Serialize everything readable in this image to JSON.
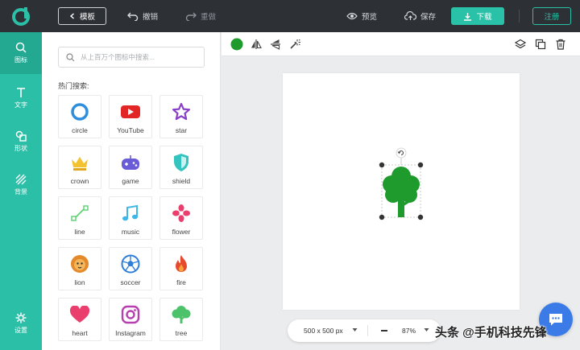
{
  "topbar": {
    "back_label": "模板",
    "undo_label": "撤销",
    "redo_label": "重做",
    "preview_label": "预览",
    "save_label": "保存",
    "download_label": "下载",
    "register_label": "注册"
  },
  "rail": {
    "items": [
      {
        "label": "图标",
        "icon": "search-icon"
      },
      {
        "label": "文字",
        "icon": "text-icon"
      },
      {
        "label": "形状",
        "icon": "shapes-icon"
      },
      {
        "label": "背景",
        "icon": "background-icon"
      },
      {
        "label": "设置",
        "icon": "settings-icon"
      }
    ]
  },
  "panel": {
    "search_placeholder": "从上百万个图标中搜索...",
    "hot_label": "热门搜索:",
    "icons": [
      {
        "label": "circle",
        "icon": "circle-icon",
        "color": "#2f8fdc"
      },
      {
        "label": "YouTube",
        "icon": "youtube-icon",
        "color": "#e22626"
      },
      {
        "label": "star",
        "icon": "star-icon",
        "color": "#8a3fc8"
      },
      {
        "label": "crown",
        "icon": "crown-icon",
        "color": "#f2c230"
      },
      {
        "label": "game",
        "icon": "gamepad-icon",
        "color": "#6a5bd6"
      },
      {
        "label": "shield",
        "icon": "shield-icon",
        "color": "#33c4c0"
      },
      {
        "label": "line",
        "icon": "line-icon",
        "color": "#5ad06e"
      },
      {
        "label": "music",
        "icon": "music-icon",
        "color": "#3fb6e8"
      },
      {
        "label": "flower",
        "icon": "flower-icon",
        "color": "#ea3f6e"
      },
      {
        "label": "lion",
        "icon": "lion-icon",
        "color": "#e48a2a"
      },
      {
        "label": "soccer",
        "icon": "soccer-icon",
        "color": "#2f7fd8"
      },
      {
        "label": "fire",
        "icon": "fire-icon",
        "color": "#e64a2e"
      },
      {
        "label": "heart",
        "icon": "heart-icon",
        "color": "#ea3f6e"
      },
      {
        "label": "Instagram",
        "icon": "instagram-icon",
        "color": "#b83fb0"
      },
      {
        "label": "tree",
        "icon": "tree-icon",
        "color": "#4cc36a"
      }
    ]
  },
  "canvas": {
    "fill_color": "#1f9b2e",
    "selected_icon": "tree-icon"
  },
  "bottom": {
    "size_label": "500 x 500 px",
    "zoom_label": "87%"
  },
  "watermark": "头条 @手机科技先锋",
  "colors": {
    "accent": "#29c2a8",
    "topbar": "#2d3035",
    "rail": "#2bbfa7"
  }
}
